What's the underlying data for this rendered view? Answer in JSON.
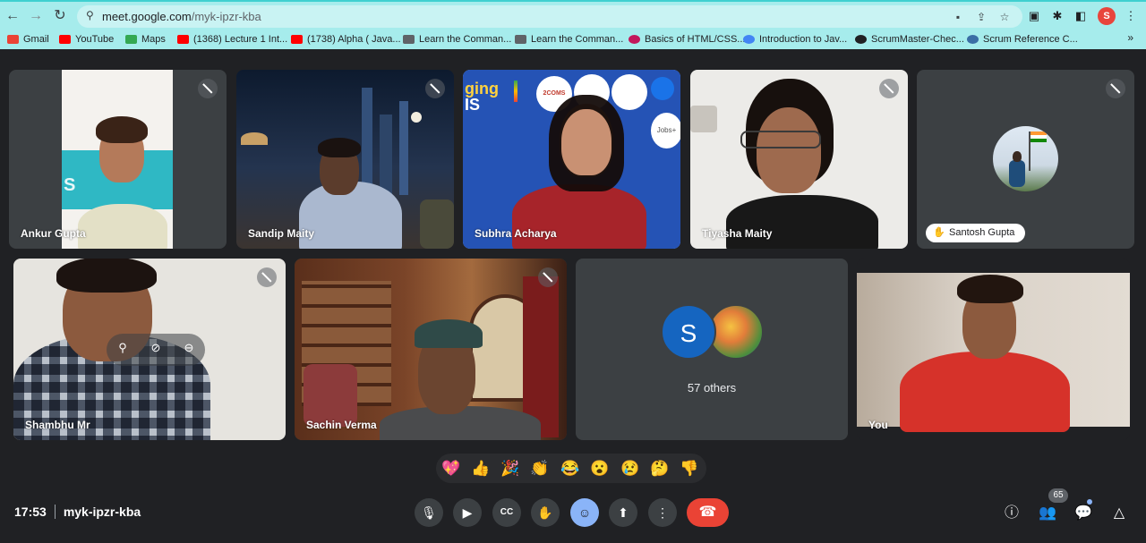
{
  "browser": {
    "url_host": "meet.google.com",
    "url_path": "/myk-ipzr-kba",
    "profile_initial": "S",
    "bookmarks": [
      {
        "label": "Gmail",
        "color": "#ea4335"
      },
      {
        "label": "YouTube",
        "color": "#ff0000"
      },
      {
        "label": "Maps",
        "color": "#34a853"
      },
      {
        "label": "(1368) Lecture 1 Int...",
        "color": "#ff0000"
      },
      {
        "label": "(1738) Alpha ( Java...",
        "color": "#ff0000"
      },
      {
        "label": "Learn the Comman...",
        "color": "#5f6368"
      },
      {
        "label": "Learn the Comman...",
        "color": "#5f6368"
      },
      {
        "label": "Basics of HTML/CSS...",
        "color": "#c2185b"
      },
      {
        "label": "Introduction to Jav...",
        "color": "#4285f4"
      },
      {
        "label": "ScrumMaster-Chec...",
        "color": "#202124"
      },
      {
        "label": "Scrum Reference C...",
        "color": "#3a6ea5"
      }
    ],
    "more_label": "»"
  },
  "participants": [
    {
      "name": "Ankur Gupta"
    },
    {
      "name": "Sandip Maity"
    },
    {
      "name": "Subhra Acharya"
    },
    {
      "name": "Tiyasha Maity"
    },
    {
      "name": "Santosh Gupta"
    },
    {
      "name": "Shambhu Mr"
    },
    {
      "name": "Sachin Verma"
    },
    {
      "name": "You"
    }
  ],
  "others": {
    "initial": "S",
    "label": "57 others"
  },
  "subhra_bg": {
    "banner_text": "ging",
    "banner_sub": "IS",
    "logo1": "2COMS",
    "logo2": "Jobs+"
  },
  "reactions": [
    "💖",
    "👍",
    "🎉",
    "👏",
    "😂",
    "😮",
    "😢",
    "🤔",
    "👎"
  ],
  "meeting": {
    "time": "17:53",
    "code": "myk-ipzr-kba"
  },
  "people_count": "65",
  "colors": {
    "accent": "#8ab4f8",
    "end_call": "#ea4335",
    "tile_bg": "#3c4043",
    "page_bg": "#202124"
  }
}
